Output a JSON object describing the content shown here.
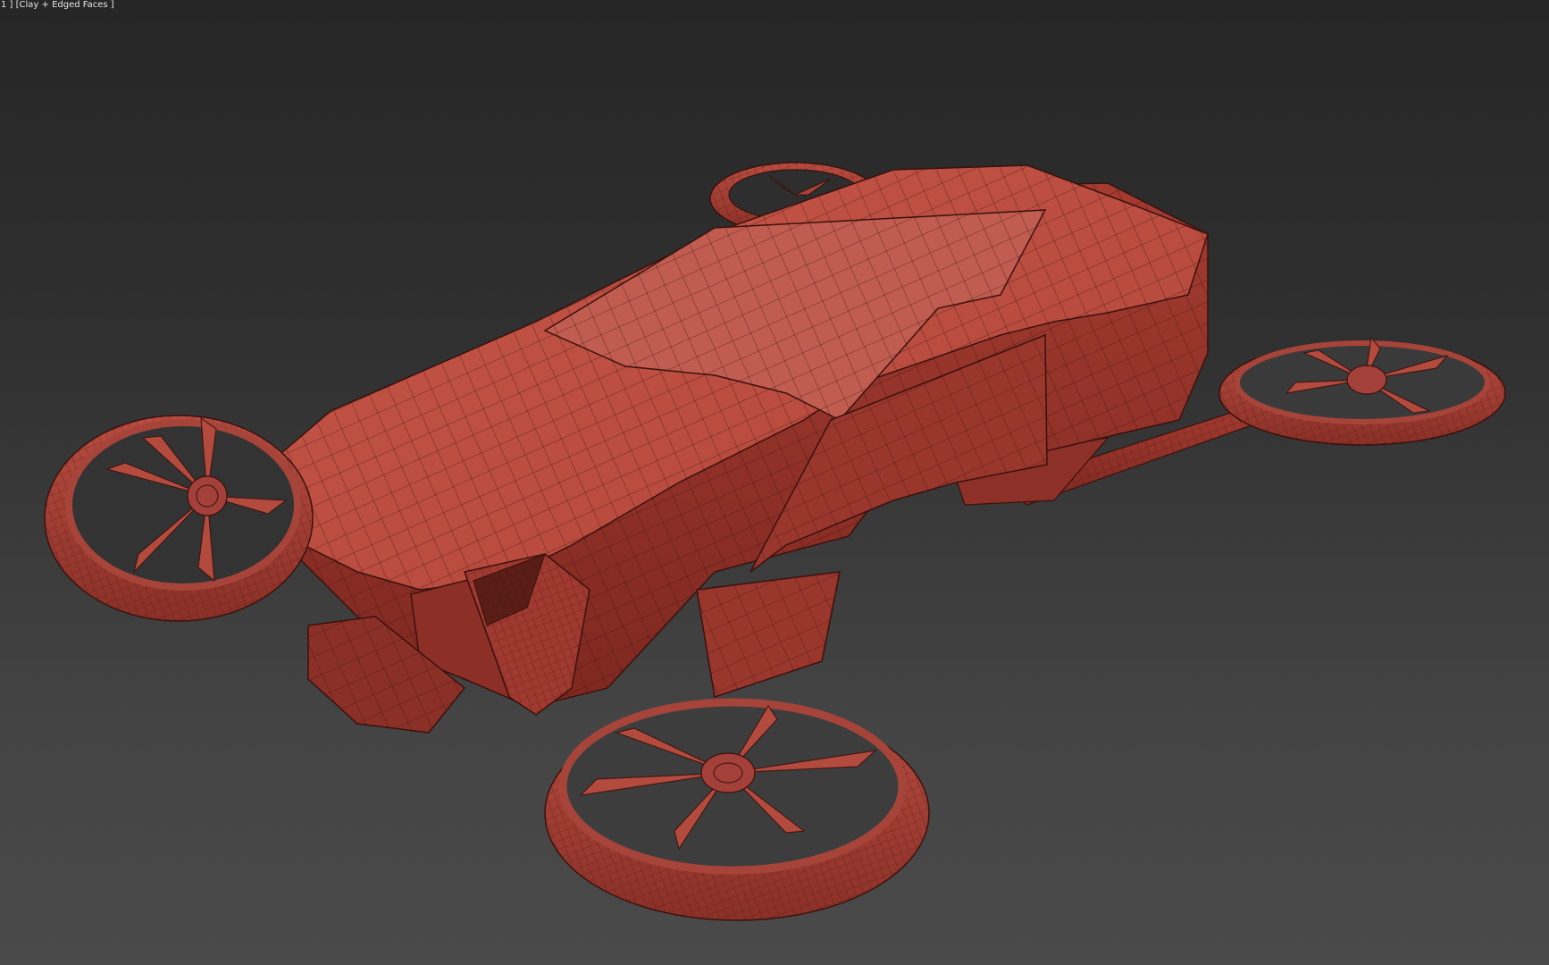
{
  "viewport": {
    "label": "1 ] [Clay + Edged Faces ]"
  },
  "model": {
    "base_color": "#b94c40",
    "shadow_color": "#7a2a23",
    "highlight_color": "#cf6a5c",
    "wire_color": "#3a110d"
  }
}
